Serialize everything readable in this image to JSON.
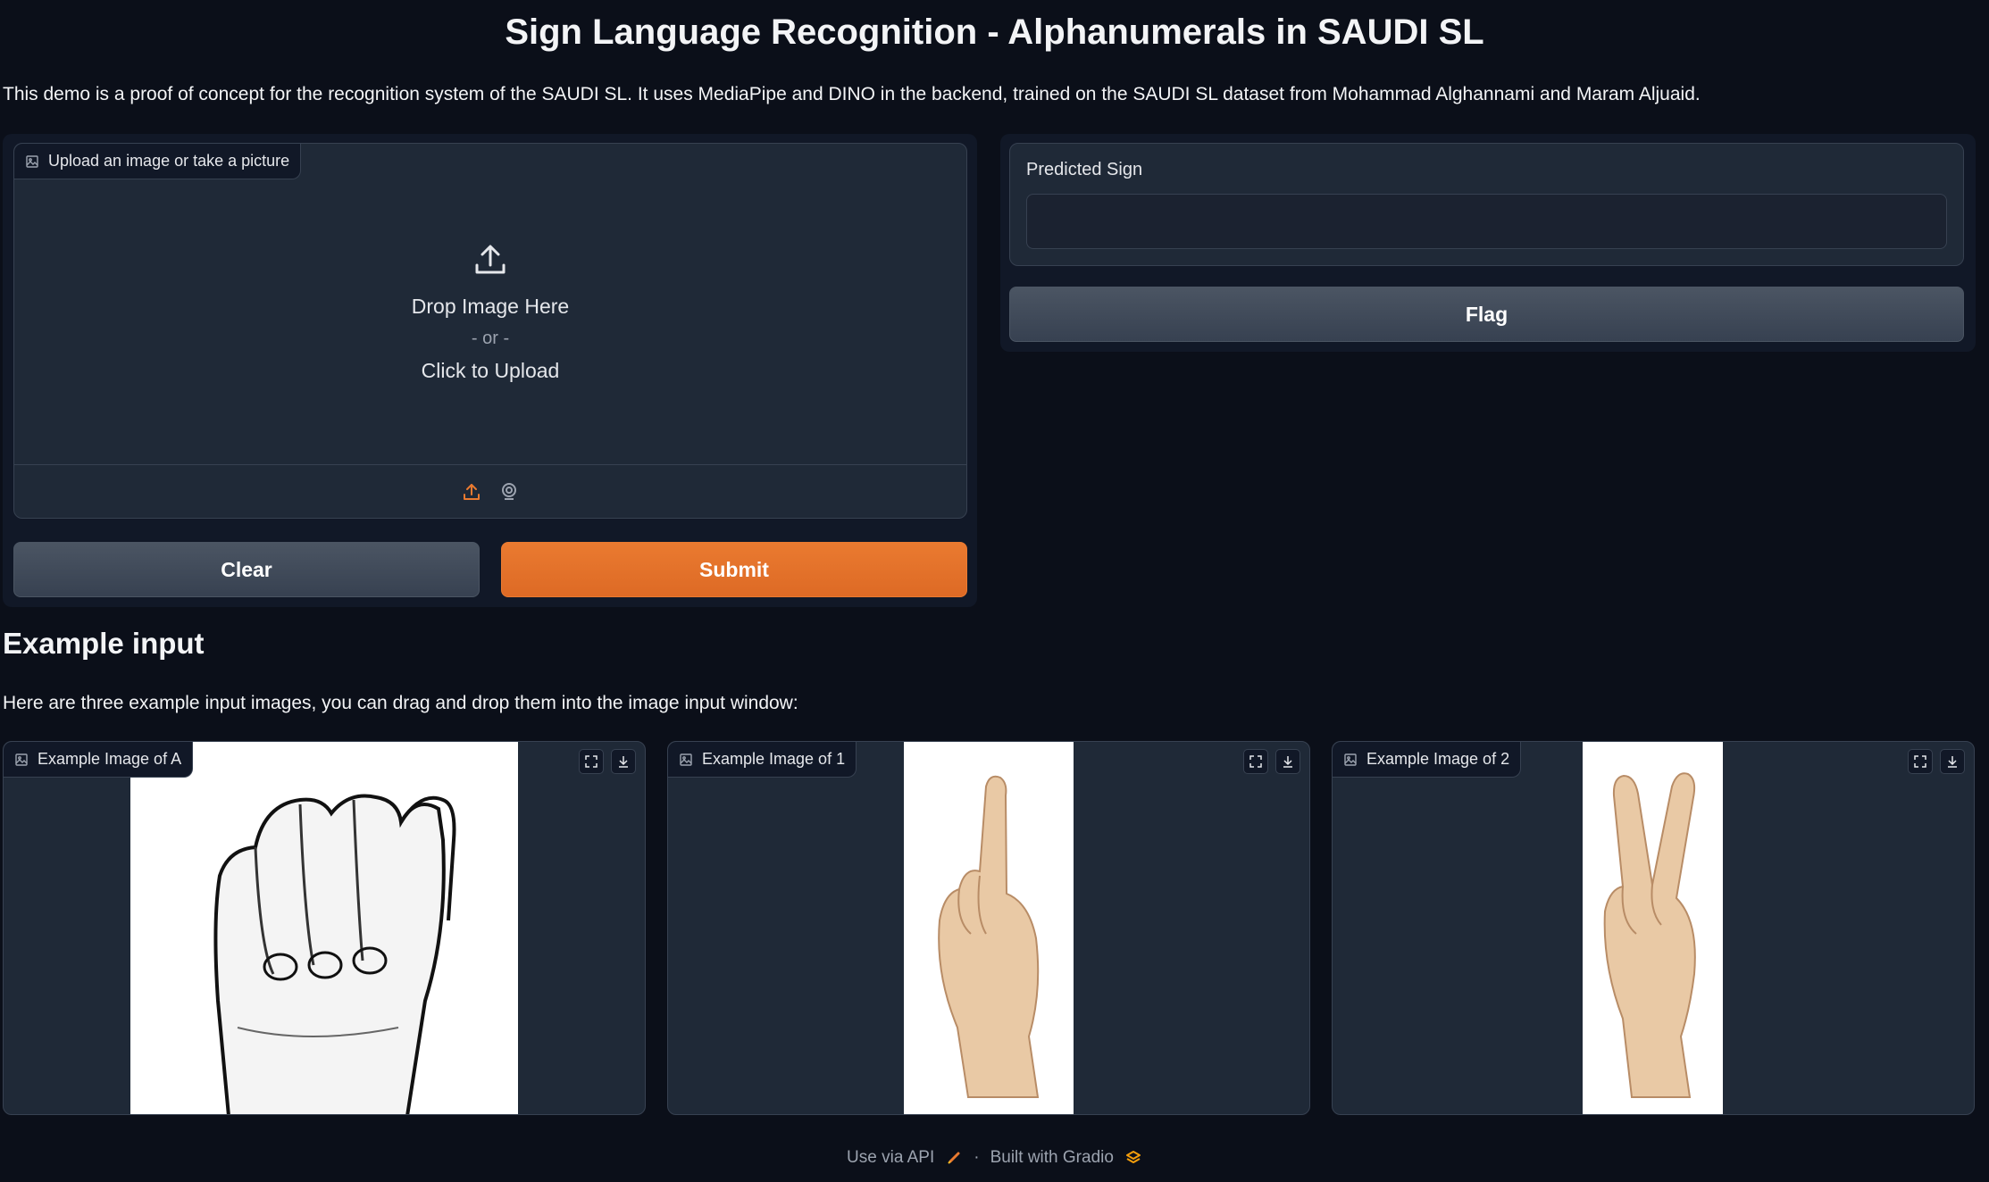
{
  "page": {
    "title": "Sign Language Recognition - Alphanumerals in SAUDI SL",
    "description": "This demo is a proof of concept for the recognition system of the SAUDI SL. It uses MediaPipe and DINO in the backend, trained on the SAUDI SL dataset from Mohammad Alghannami and Maram Aljuaid."
  },
  "input": {
    "label": "Upload an image or take a picture",
    "drop_text": "Drop Image Here",
    "or_text": "- or -",
    "click_text": "Click to Upload",
    "sources": [
      "upload-icon",
      "webcam-icon"
    ]
  },
  "buttons": {
    "clear": "Clear",
    "submit": "Submit",
    "flag": "Flag"
  },
  "output": {
    "label": "Predicted Sign",
    "value": ""
  },
  "examples": {
    "heading": "Example input",
    "subtitle": "Here are three example input images, you can drag and drop them into the image input window:",
    "items": [
      {
        "label": "Example Image of A"
      },
      {
        "label": "Example Image of 1"
      },
      {
        "label": "Example Image of 2"
      }
    ]
  },
  "footer": {
    "api": "Use via API",
    "separator": "·",
    "built": "Built with Gradio"
  },
  "colors": {
    "background": "#0b0f19",
    "panel": "#111827",
    "block": "#1f2937",
    "primary": "#ea7a30",
    "secondary": "#4b5563"
  }
}
